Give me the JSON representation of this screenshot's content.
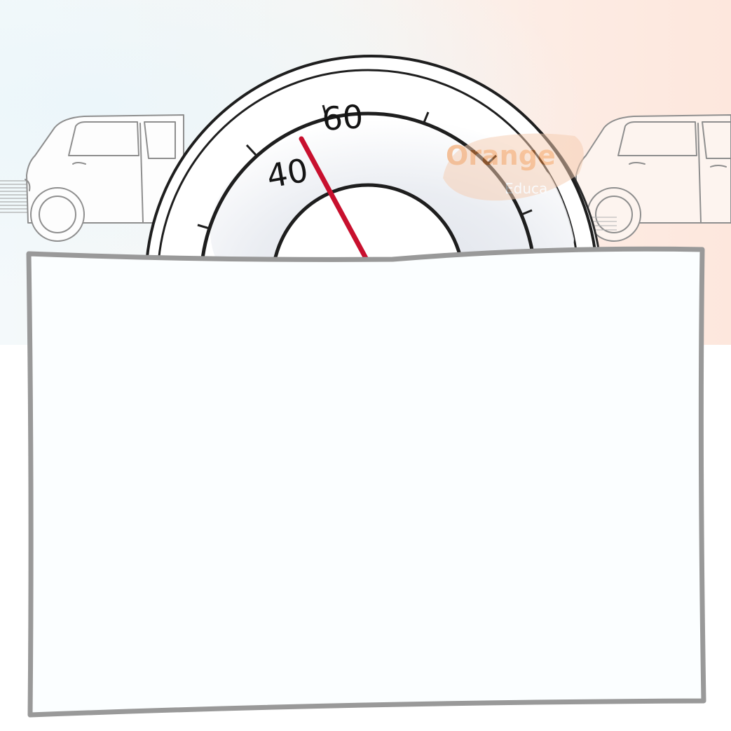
{
  "speedometer": {
    "labels": [
      "40",
      "60"
    ],
    "needle_color": "#c8102e"
  },
  "watermark": {
    "brand": "Orange",
    "sub": "Educa"
  },
  "colors": {
    "card_fill": "#fbfeff",
    "card_border": "#999999",
    "bg_left": "#f4f9fb",
    "bg_right": "#fde7dd",
    "watermark_orange": "#f28a3c",
    "watermark_green": "#c6d64a"
  }
}
